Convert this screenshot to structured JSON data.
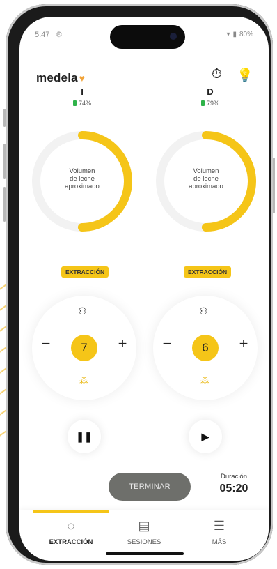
{
  "status_bar": {
    "time": "5:47",
    "battery": "80%"
  },
  "app": {
    "logo": "medela"
  },
  "left": {
    "side": "I",
    "battery": "74%",
    "volume_label": [
      "Volumen",
      "de leche",
      "aproximado"
    ],
    "phase": "EXTRACCIÓN",
    "level": "7",
    "progress_fraction": 0.5,
    "playback": "paused",
    "action_icon": "pause-icon"
  },
  "right": {
    "side": "D",
    "battery": "79%",
    "volume_label": [
      "Volumen",
      "de leche",
      "aproximado"
    ],
    "phase": "EXTRACCIÓN",
    "level": "6",
    "progress_fraction": 0.5,
    "playback": "stopped",
    "action_icon": "play-icon"
  },
  "controls": {
    "minus": "−",
    "plus": "+"
  },
  "footer": {
    "terminate_label": "TERMINAR",
    "duration_label": "Duración",
    "duration_value": "05:20"
  },
  "tabs": [
    {
      "label": "EXTRACCIÓN",
      "icon": "pump-icon",
      "active": true
    },
    {
      "label": "SESIONES",
      "icon": "list-icon",
      "active": false
    },
    {
      "label": "MÁS",
      "icon": "menu-icon",
      "active": false
    }
  ],
  "colors": {
    "accent": "#f5c518",
    "ring_track": "#f2f2f2",
    "button_dark": "#6e6f6b",
    "battery_green": "#2fb34a"
  }
}
